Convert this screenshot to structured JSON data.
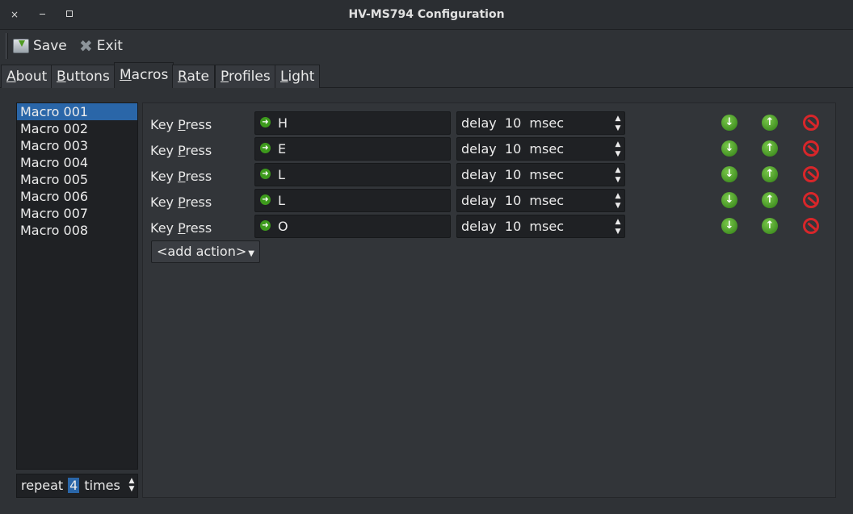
{
  "window": {
    "title": "HV-MS794 Configuration",
    "close_glyph": "×",
    "min_glyph": "",
    "max_glyph": ""
  },
  "toolbar": {
    "save_label": "Save",
    "exit_label": "Exit"
  },
  "tabs": [
    {
      "label": "About",
      "active": false
    },
    {
      "label": "Buttons",
      "active": false
    },
    {
      "label": "Macros",
      "active": true
    },
    {
      "label": "Rate",
      "active": false
    },
    {
      "label": "Profiles",
      "active": false
    },
    {
      "label": "Light",
      "active": false
    }
  ],
  "macros": {
    "items": [
      "Macro 001",
      "Macro 002",
      "Macro 003",
      "Macro 004",
      "Macro 005",
      "Macro 006",
      "Macro 007",
      "Macro 008"
    ],
    "selected_index": 0,
    "repeat_prefix": "repeat",
    "repeat_value": "4",
    "repeat_suffix": "times"
  },
  "actions": [
    {
      "type_prefix": "Key ",
      "type_mnemonic": "P",
      "type_rest": "ress",
      "key": "H",
      "delay_text": "delay  10  msec"
    },
    {
      "type_prefix": "Key ",
      "type_mnemonic": "P",
      "type_rest": "ress",
      "key": "E",
      "delay_text": "delay  10  msec"
    },
    {
      "type_prefix": "Key ",
      "type_mnemonic": "P",
      "type_rest": "ress",
      "key": "L",
      "delay_text": "delay  10  msec"
    },
    {
      "type_prefix": "Key ",
      "type_mnemonic": "P",
      "type_rest": "ress",
      "key": "L",
      "delay_text": "delay  10  msec"
    },
    {
      "type_prefix": "Key ",
      "type_mnemonic": "P",
      "type_rest": "ress",
      "key": "O",
      "delay_text": "delay  10  msec"
    }
  ],
  "add_action_label": "<add action>",
  "icons": {
    "move_down": "arrow-down-icon",
    "move_up": "arrow-up-icon",
    "delete": "delete-icon"
  },
  "colors": {
    "selection": "#2a66a8",
    "green": "#3d9a1c",
    "red": "#d8262a"
  }
}
